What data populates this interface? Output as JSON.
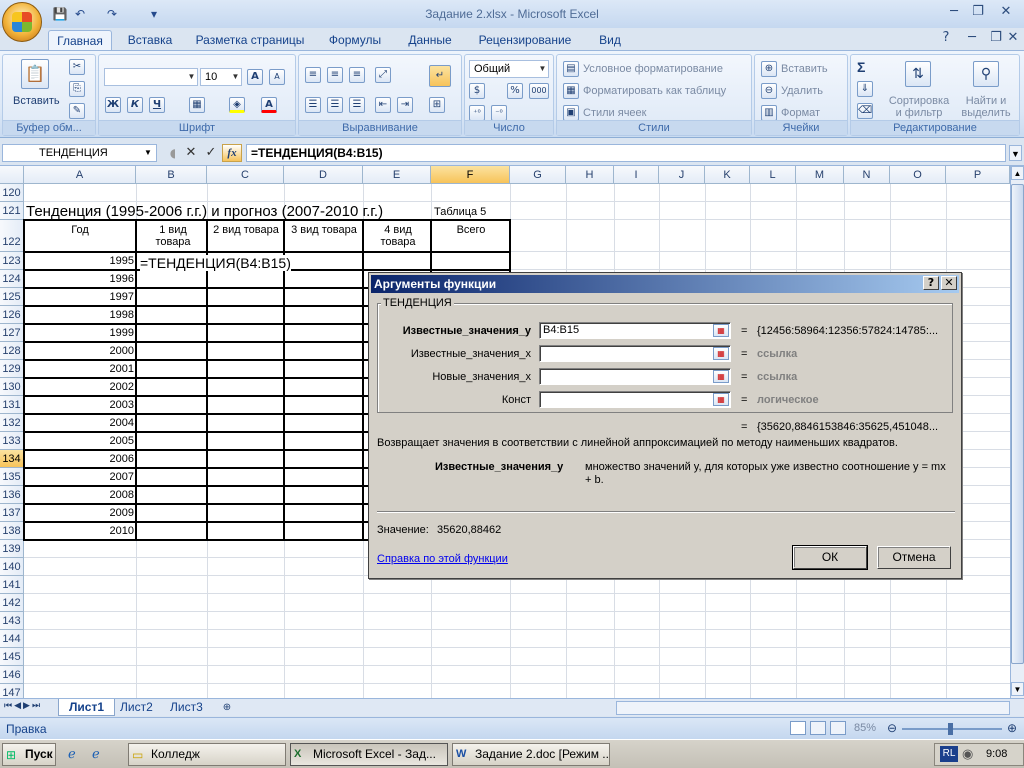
{
  "window": {
    "title": "Задание 2.xlsx - Microsoft Excel",
    "min": "─",
    "max": "❐",
    "close": "✕",
    "help": "?"
  },
  "ribbon_tabs": [
    "Главная",
    "Вставка",
    "Разметка страницы",
    "Формулы",
    "Данные",
    "Рецензирование",
    "Вид"
  ],
  "ribbon": {
    "clipboard": {
      "label": "Буфер обм...",
      "paste": "Вставить"
    },
    "font": {
      "label": "Шрифт",
      "size": "10",
      "bold": "Ж",
      "italic": "К",
      "underline": "Ч",
      "grow": "A",
      "shrink": "A",
      "color": "A"
    },
    "alignment": {
      "label": "Выравнивание"
    },
    "number": {
      "label": "Число",
      "format": "Общий",
      "percent": "%",
      "thousands": "000"
    },
    "styles": {
      "label": "Стили",
      "conditional": "Условное форматирование",
      "table": "Форматировать как таблицу",
      "cell_styles": "Стили ячеек"
    },
    "cells": {
      "label": "Ячейки",
      "insert": "Вставить",
      "delete": "Удалить",
      "format": "Формат"
    },
    "editing": {
      "label": "Редактирование",
      "sum": "Σ",
      "sort": "Сортировка и фильтр",
      "find": "Найти и выделить"
    }
  },
  "formula_bar": {
    "name_box": "ТЕНДЕНЦИЯ",
    "fx": "fx",
    "formula": "=ТЕНДЕНЦИЯ(B4:B15)"
  },
  "columns": [
    "A",
    "B",
    "C",
    "D",
    "E",
    "F",
    "G",
    "H",
    "I",
    "J",
    "K",
    "L",
    "M",
    "N",
    "O",
    "P"
  ],
  "rows": [
    "120",
    "121",
    "122",
    "123",
    "124",
    "125",
    "126",
    "127",
    "128",
    "129",
    "130",
    "131",
    "132",
    "133",
    "134",
    "135",
    "136",
    "137",
    "138",
    "139",
    "140",
    "141",
    "142",
    "143",
    "144",
    "145",
    "146",
    "147"
  ],
  "sheet": {
    "title": "Тенденция (1995-2006 г.г.) и прогноз (2007-2010 г.г.)",
    "table_label": "Таблица 5",
    "headers": [
      "Год",
      "1 вид товара",
      "2 вид товара",
      "3 вид товара",
      "4 вид товара",
      "Всего"
    ],
    "years": [
      "1995",
      "1996",
      "1997",
      "1998",
      "1999",
      "2000",
      "2001",
      "2002",
      "2003",
      "2004",
      "2005",
      "2006",
      "2007",
      "2008",
      "2009",
      "2010"
    ],
    "edit_cell": "=ТЕНДЕНЦИЯ(B4:B15)"
  },
  "sheet_tabs": [
    "Лист1",
    "Лист2",
    "Лист3"
  ],
  "status": {
    "mode": "Правка",
    "zoom": "85%"
  },
  "taskbar": {
    "start": "Пуск",
    "items": [
      "Колледж",
      "Microsoft Excel - Зад...",
      "Задание 2.doc [Режим ..."
    ],
    "lang": "RL",
    "time": "9:08"
  },
  "dialog": {
    "title": "Аргументы функции",
    "function": "ТЕНДЕНЦИЯ",
    "args": [
      {
        "label": "Известные_значения_y",
        "value": "B4:B15",
        "result": "{12456:58964:12356:57824:14785:..."
      },
      {
        "label": "Известные_значения_x",
        "value": "",
        "result": "ссылка"
      },
      {
        "label": "Новые_значения_x",
        "value": "",
        "result": "ссылка"
      },
      {
        "label": "Конст",
        "value": "",
        "result": "логическое"
      }
    ],
    "eq": "=",
    "total_result": "{35620,8846153846:35625,451048...",
    "description": "Возвращает значения в соответствии с линейной аппроксимацией по методу наименьших квадратов.",
    "arg_help_label": "Известные_значения_y",
    "arg_help_text": "множество значений y, для которых уже известно соотношение y = mx + b.",
    "value_label": "Значение:",
    "value": "35620,88462",
    "help_link": "Справка по этой функции",
    "ok": "ОК",
    "cancel": "Отмена"
  }
}
